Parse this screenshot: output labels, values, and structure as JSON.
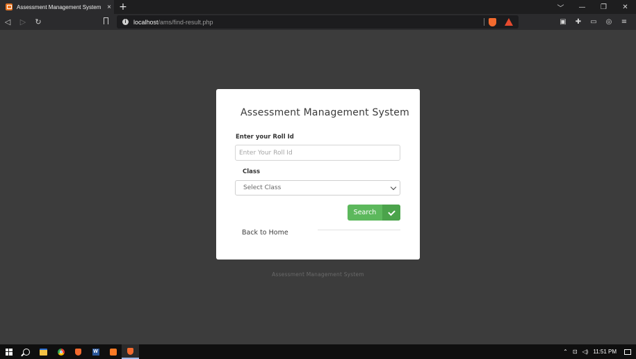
{
  "browser": {
    "tab_title": "Assessment Management System",
    "tab_close": "×",
    "new_tab": "+",
    "url_host": "localhost",
    "url_path": "/ams/find-result.php",
    "window_controls": [
      "﹀",
      "—",
      "❐",
      "✕"
    ]
  },
  "card": {
    "title": "Assessment Management System",
    "roll_label": "Enter your Roll Id",
    "roll_placeholder": "Enter Your Roll Id",
    "class_label": "Class",
    "class_selected": "Select Class",
    "search_label": "Search",
    "back_label": "Back to Home"
  },
  "footer": {
    "text": "Assessment Management System"
  },
  "taskbar": {
    "time": "11:51 PM"
  },
  "colors": {
    "page_bg": "#3c3c3c",
    "search_button": "#5cb85c",
    "brave_orange": "#f36a2e"
  }
}
